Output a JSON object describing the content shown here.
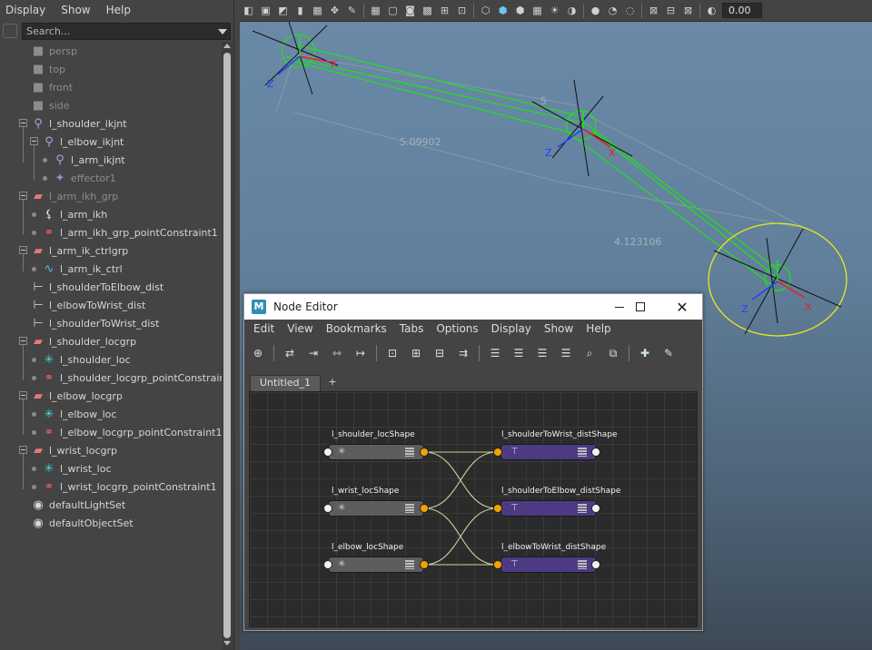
{
  "outliner": {
    "menu": [
      "Display",
      "Show",
      "Help"
    ],
    "search_placeholder": "Search...",
    "items": [
      {
        "label": "persp",
        "icon": "camera-icon"
      },
      {
        "label": "top",
        "icon": "camera-icon"
      },
      {
        "label": "front",
        "icon": "camera-icon"
      },
      {
        "label": "side",
        "icon": "camera-icon"
      },
      {
        "label": "l_shoulder_ikjnt",
        "icon": "joint-icon"
      },
      {
        "label": "l_elbow_ikjnt",
        "icon": "joint-icon"
      },
      {
        "label": "l_arm_ikjnt",
        "icon": "joint-icon"
      },
      {
        "label": "effector1",
        "icon": "effector-icon"
      },
      {
        "label": "l_arm_ikh_grp",
        "icon": "group-icon"
      },
      {
        "label": "l_arm_ikh",
        "icon": "ik-handle-icon"
      },
      {
        "label": "l_arm_ikh_grp_pointConstraint1",
        "icon": "constraint-icon"
      },
      {
        "label": "l_arm_ik_ctrlgrp",
        "icon": "group-icon"
      },
      {
        "label": "l_arm_ik_ctrl",
        "icon": "curve-icon"
      },
      {
        "label": "l_shoulderToElbow_dist",
        "icon": "distance-icon"
      },
      {
        "label": "l_elbowToWrist_dist",
        "icon": "distance-icon"
      },
      {
        "label": "l_shoulderToWrist_dist",
        "icon": "distance-icon"
      },
      {
        "label": "l_shoulder_locgrp",
        "icon": "group-icon"
      },
      {
        "label": "l_shoulder_loc",
        "icon": "locator-icon"
      },
      {
        "label": "l_shoulder_locgrp_pointConstraint",
        "icon": "constraint-icon"
      },
      {
        "label": "l_elbow_locgrp",
        "icon": "group-icon"
      },
      {
        "label": "l_elbow_loc",
        "icon": "locator-icon"
      },
      {
        "label": "l_elbow_locgrp_pointConstraint1",
        "icon": "constraint-icon"
      },
      {
        "label": "l_wrist_locgrp",
        "icon": "group-icon"
      },
      {
        "label": "l_wrist_loc",
        "icon": "locator-icon"
      },
      {
        "label": "l_wrist_locgrp_pointConstraint1",
        "icon": "constraint-icon"
      },
      {
        "label": "defaultLightSet",
        "icon": "set-icon"
      },
      {
        "label": "defaultObjectSet",
        "icon": "set-icon"
      }
    ]
  },
  "viewport": {
    "toolbar_value": "0.00",
    "measure_labels": {
      "shoulder_to_elbow": "5.09902",
      "elbow_to_wrist": "4.123106",
      "short_label": "5"
    },
    "axis_labels": {
      "x": "X",
      "z": "Z"
    }
  },
  "node_editor": {
    "title": "Node Editor",
    "menu": [
      "Edit",
      "View",
      "Bookmarks",
      "Tabs",
      "Options",
      "Display",
      "Show",
      "Help"
    ],
    "tab": "Untitled_1",
    "tab_add": "+",
    "nodes": {
      "l_shoulder_locShape": "l_shoulder_locShape",
      "l_wrist_locShape": "l_wrist_locShape",
      "l_elbow_locShape": "l_elbow_locShape",
      "l_shoulderToWrist_distShape": "l_shoulderToWrist_distShape",
      "l_shoulderToElbow_distShape": "l_shoulderToElbow_distShape",
      "l_elbowToWrist_distShape": "l_elbowToWrist_distShape"
    }
  },
  "colors": {
    "locator_node": "#5d5d5d",
    "distance_node": "#4e3a83",
    "output_port": "#f2a200",
    "wire": "#c6cf9a",
    "viewport_green": "#22dd22",
    "selection_yellow": "#e8e820"
  }
}
